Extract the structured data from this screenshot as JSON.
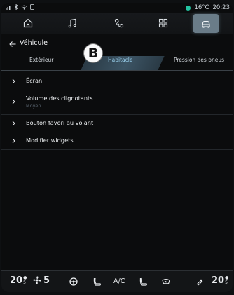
{
  "status": {
    "left_icons": [
      "signal-icon",
      "bluetooth-icon",
      "wifi-icon",
      "phone-icon"
    ],
    "temperature": "16°C",
    "time": "20:23"
  },
  "nav": {
    "items": [
      "home-icon",
      "music-icon",
      "phone-icon",
      "apps-icon",
      "car-icon"
    ],
    "active": "car-icon"
  },
  "header": {
    "title": "Véhicule"
  },
  "tabs": [
    "Extérieur",
    "Habitacle",
    "Pression des pneus"
  ],
  "active_tab": "Habitacle",
  "badge": "B",
  "list": [
    {
      "label": "Écran"
    },
    {
      "label": "Volume des clignotants",
      "sub": "Moyen"
    },
    {
      "label": "Bouton favori au volant"
    },
    {
      "label": "Modifier widgets"
    }
  ],
  "bottom": {
    "left_temp": "20",
    "fan": "5",
    "ac": "A/C",
    "right_temp": "20"
  },
  "colors": {
    "accent": "#9ad1ee",
    "active_nav": "#6a7c88",
    "status_green": "#23c3a1"
  }
}
